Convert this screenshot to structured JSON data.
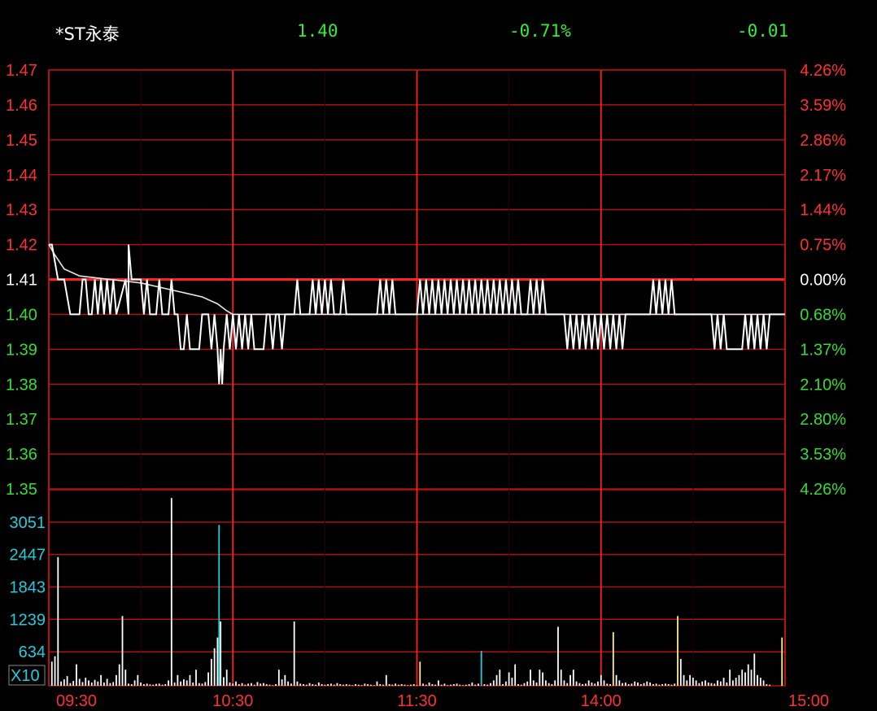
{
  "header": {
    "name": "*ST永泰",
    "price": "1.40",
    "change_pct": "-0.71%",
    "change": "-0.01"
  },
  "colors": {
    "background": "#000000",
    "grid": "#b01010",
    "grid_major": "#ff2020",
    "price_line": "#ffffff",
    "avg_line": "#ffffff",
    "up_text": "#ff3030",
    "down_text": "#33dd33",
    "neutral_text": "#ffffff",
    "volume_axis_text": "#22ccdd",
    "volume_bar": "#ffffff",
    "volume_bar_alt": "#ffee88",
    "volume_bar_alt2": "#22ccdd"
  },
  "chart_data": {
    "type": "line",
    "prev_close": 1.41,
    "price_axis": {
      "ticks": [
        "1.47",
        "1.46",
        "1.45",
        "1.44",
        "1.43",
        "1.42",
        "1.41",
        "1.40",
        "1.39",
        "1.38",
        "1.37",
        "1.36",
        "1.35"
      ],
      "ylim": [
        1.35,
        1.47
      ]
    },
    "pct_axis": {
      "ticks": [
        "4.26%",
        "3.59%",
        "2.86%",
        "2.17%",
        "1.44%",
        "0.75%",
        "0.00%",
        "0.68%",
        "1.37%",
        "2.10%",
        "2.80%",
        "3.53%",
        "4.26%"
      ]
    },
    "volume_axis": {
      "ticks": [
        "3051",
        "2447",
        "1843",
        "1239",
        "634"
      ],
      "unit": "X10",
      "ylim": [
        0,
        3655
      ]
    },
    "time_ticks": [
      "09:30",
      "10:30",
      "11:30",
      "14:00",
      "15:00"
    ],
    "total_minutes": 240,
    "price_series": [
      [
        0,
        1.42
      ],
      [
        1,
        1.42
      ],
      [
        3,
        1.41
      ],
      [
        5,
        1.41
      ],
      [
        7,
        1.4
      ],
      [
        10,
        1.4
      ],
      [
        11,
        1.41
      ],
      [
        12,
        1.41
      ],
      [
        13,
        1.4
      ],
      [
        14,
        1.4
      ],
      [
        15,
        1.41
      ],
      [
        16,
        1.4
      ],
      [
        17,
        1.41
      ],
      [
        18,
        1.4
      ],
      [
        19,
        1.41
      ],
      [
        20,
        1.4
      ],
      [
        21,
        1.41
      ],
      [
        22,
        1.4
      ],
      [
        26,
        1.4
      ],
      [
        27,
        1.41
      ],
      [
        25,
        1.41
      ],
      [
        26,
        1.42
      ],
      [
        27,
        1.41
      ],
      [
        30,
        1.41
      ],
      [
        31,
        1.4
      ],
      [
        32,
        1.41
      ],
      [
        33,
        1.4
      ],
      [
        35,
        1.4
      ],
      [
        36,
        1.41
      ],
      [
        37,
        1.4
      ],
      [
        39,
        1.4
      ],
      [
        40,
        1.41
      ],
      [
        41,
        1.4
      ],
      [
        42,
        1.4
      ],
      [
        43,
        1.39
      ],
      [
        44,
        1.39
      ],
      [
        45,
        1.4
      ],
      [
        46,
        1.39
      ],
      [
        49,
        1.39
      ],
      [
        50,
        1.4
      ],
      [
        52,
        1.4
      ],
      [
        53,
        1.39
      ],
      [
        54,
        1.4
      ],
      [
        55,
        1.39
      ],
      [
        55.5,
        1.38
      ],
      [
        56,
        1.39
      ],
      [
        56.5,
        1.38
      ],
      [
        57,
        1.39
      ],
      [
        58,
        1.4
      ],
      [
        59,
        1.39
      ],
      [
        60,
        1.4
      ],
      [
        61,
        1.39
      ],
      [
        62,
        1.4
      ],
      [
        63,
        1.39
      ],
      [
        64,
        1.4
      ],
      [
        65,
        1.39
      ],
      [
        66,
        1.4
      ],
      [
        67,
        1.39
      ],
      [
        70,
        1.39
      ],
      [
        71,
        1.4
      ],
      [
        72,
        1.4
      ],
      [
        73,
        1.39
      ],
      [
        74,
        1.4
      ],
      [
        75,
        1.4
      ],
      [
        76,
        1.39
      ],
      [
        77,
        1.4
      ],
      [
        80,
        1.4
      ],
      [
        81,
        1.41
      ],
      [
        82,
        1.4
      ],
      [
        85,
        1.4
      ],
      [
        86,
        1.41
      ],
      [
        87,
        1.4
      ],
      [
        88,
        1.41
      ],
      [
        89,
        1.4
      ],
      [
        90,
        1.41
      ],
      [
        91,
        1.4
      ],
      [
        92,
        1.41
      ],
      [
        93,
        1.4
      ],
      [
        95,
        1.4
      ],
      [
        96,
        1.41
      ],
      [
        97,
        1.4
      ],
      [
        107,
        1.4
      ],
      [
        108,
        1.41
      ],
      [
        109,
        1.4
      ],
      [
        110,
        1.41
      ],
      [
        111,
        1.4
      ],
      [
        112,
        1.41
      ],
      [
        113,
        1.4
      ],
      [
        120,
        1.4
      ],
      [
        121,
        1.41
      ],
      [
        122,
        1.4
      ],
      [
        123,
        1.41
      ],
      [
        124,
        1.4
      ],
      [
        125,
        1.41
      ],
      [
        126,
        1.4
      ],
      [
        127,
        1.41
      ],
      [
        128,
        1.4
      ],
      [
        129,
        1.41
      ],
      [
        130,
        1.4
      ],
      [
        131,
        1.41
      ],
      [
        132,
        1.4
      ],
      [
        133,
        1.41
      ],
      [
        134,
        1.4
      ],
      [
        135,
        1.41
      ],
      [
        136,
        1.4
      ],
      [
        137,
        1.41
      ],
      [
        138,
        1.4
      ],
      [
        139,
        1.41
      ],
      [
        140,
        1.4
      ],
      [
        141,
        1.41
      ],
      [
        142,
        1.4
      ],
      [
        143,
        1.41
      ],
      [
        144,
        1.4
      ],
      [
        145,
        1.41
      ],
      [
        146,
        1.4
      ],
      [
        147,
        1.41
      ],
      [
        148,
        1.4
      ],
      [
        149,
        1.41
      ],
      [
        150,
        1.4
      ],
      [
        151,
        1.41
      ],
      [
        152,
        1.4
      ],
      [
        153,
        1.41
      ],
      [
        154,
        1.4
      ],
      [
        156,
        1.4
      ],
      [
        157,
        1.41
      ],
      [
        158,
        1.4
      ],
      [
        159,
        1.41
      ],
      [
        160,
        1.4
      ],
      [
        161,
        1.41
      ],
      [
        162,
        1.4
      ],
      [
        168,
        1.4
      ],
      [
        169,
        1.39
      ],
      [
        170,
        1.4
      ],
      [
        171,
        1.39
      ],
      [
        172,
        1.4
      ],
      [
        173,
        1.39
      ],
      [
        174,
        1.4
      ],
      [
        175,
        1.39
      ],
      [
        176,
        1.4
      ],
      [
        177,
        1.39
      ],
      [
        178,
        1.4
      ],
      [
        179,
        1.39
      ],
      [
        180,
        1.4
      ],
      [
        181,
        1.39
      ],
      [
        182,
        1.4
      ],
      [
        183,
        1.39
      ],
      [
        184,
        1.4
      ],
      [
        185,
        1.39
      ],
      [
        186,
        1.4
      ],
      [
        187,
        1.39
      ],
      [
        188,
        1.4
      ],
      [
        196,
        1.4
      ],
      [
        197,
        1.41
      ],
      [
        198,
        1.4
      ],
      [
        199,
        1.41
      ],
      [
        200,
        1.4
      ],
      [
        201,
        1.41
      ],
      [
        202,
        1.4
      ],
      [
        203,
        1.41
      ],
      [
        204,
        1.4
      ],
      [
        216,
        1.4
      ],
      [
        217,
        1.39
      ],
      [
        218,
        1.4
      ],
      [
        219,
        1.39
      ],
      [
        220,
        1.4
      ],
      [
        221,
        1.39
      ],
      [
        226,
        1.39
      ],
      [
        227,
        1.4
      ],
      [
        228,
        1.39
      ],
      [
        229,
        1.4
      ],
      [
        230,
        1.39
      ],
      [
        231,
        1.4
      ],
      [
        232,
        1.39
      ],
      [
        233,
        1.4
      ],
      [
        234,
        1.39
      ],
      [
        235,
        1.4
      ],
      [
        240,
        1.4
      ]
    ],
    "avg_series": [
      [
        0,
        1.42
      ],
      [
        2,
        1.417
      ],
      [
        5,
        1.413
      ],
      [
        10,
        1.411
      ],
      [
        20,
        1.41
      ],
      [
        30,
        1.409
      ],
      [
        40,
        1.407
      ],
      [
        45,
        1.406
      ],
      [
        50,
        1.405
      ],
      [
        55,
        1.403
      ],
      [
        58,
        1.401
      ],
      [
        60,
        1.4
      ],
      [
        80,
        1.4
      ],
      [
        120,
        1.4
      ],
      [
        150,
        1.4
      ],
      [
        170,
        1.4
      ],
      [
        190,
        1.4
      ],
      [
        195,
        1.4
      ],
      [
        200,
        1.4
      ],
      [
        240,
        1.4
      ]
    ],
    "volume_series": [
      [
        1,
        450
      ],
      [
        2,
        550
      ],
      [
        3,
        2400
      ],
      [
        4,
        80
      ],
      [
        5,
        120
      ],
      [
        6,
        180
      ],
      [
        7,
        50
      ],
      [
        8,
        90
      ],
      [
        9,
        400
      ],
      [
        10,
        130
      ],
      [
        11,
        70
      ],
      [
        12,
        150
      ],
      [
        13,
        100
      ],
      [
        14,
        60
      ],
      [
        15,
        110
      ],
      [
        16,
        80
      ],
      [
        17,
        200
      ],
      [
        18,
        60
      ],
      [
        19,
        130
      ],
      [
        20,
        50
      ],
      [
        21,
        70
      ],
      [
        22,
        200
      ],
      [
        23,
        400
      ],
      [
        24,
        1300
      ],
      [
        25,
        300
      ],
      [
        26,
        40
      ],
      [
        27,
        30
      ],
      [
        28,
        100
      ],
      [
        29,
        200
      ],
      [
        30,
        60
      ],
      [
        31,
        30
      ],
      [
        32,
        40
      ],
      [
        33,
        25
      ],
      [
        34,
        20
      ],
      [
        35,
        35
      ],
      [
        36,
        40
      ],
      [
        37,
        20
      ],
      [
        38,
        30
      ],
      [
        39,
        100
      ],
      [
        40,
        3500
      ],
      [
        41,
        60
      ],
      [
        42,
        200
      ],
      [
        43,
        80
      ],
      [
        44,
        120
      ],
      [
        45,
        100
      ],
      [
        46,
        200
      ],
      [
        47,
        60
      ],
      [
        48,
        300
      ],
      [
        49,
        50
      ],
      [
        50,
        40
      ],
      [
        51,
        70
      ],
      [
        52,
        250
      ],
      [
        53,
        500
      ],
      [
        54,
        700
      ],
      [
        55,
        900
      ],
      [
        55.5,
        3000
      ],
      [
        56,
        1200
      ],
      [
        57,
        160
      ],
      [
        58,
        300
      ],
      [
        59,
        60
      ],
      [
        60,
        40
      ],
      [
        61,
        80
      ],
      [
        62,
        30
      ],
      [
        63,
        50
      ],
      [
        64,
        20
      ],
      [
        65,
        40
      ],
      [
        66,
        50
      ],
      [
        67,
        20
      ],
      [
        68,
        70
      ],
      [
        69,
        40
      ],
      [
        70,
        50
      ],
      [
        71,
        30
      ],
      [
        72,
        20
      ],
      [
        73,
        10
      ],
      [
        74,
        30
      ],
      [
        75,
        300
      ],
      [
        76,
        120
      ],
      [
        77,
        200
      ],
      [
        78,
        80
      ],
      [
        79,
        40
      ],
      [
        80,
        1200
      ],
      [
        81,
        80
      ],
      [
        82,
        40
      ],
      [
        83,
        30
      ],
      [
        84,
        20
      ],
      [
        85,
        50
      ],
      [
        86,
        30
      ],
      [
        87,
        20
      ],
      [
        88,
        60
      ],
      [
        89,
        30
      ],
      [
        90,
        20
      ],
      [
        91,
        30
      ],
      [
        92,
        40
      ],
      [
        93,
        20
      ],
      [
        94,
        50
      ],
      [
        95,
        30
      ],
      [
        96,
        20
      ],
      [
        97,
        30
      ],
      [
        98,
        20
      ],
      [
        99,
        10
      ],
      [
        100,
        30
      ],
      [
        101,
        20
      ],
      [
        102,
        10
      ],
      [
        103,
        40
      ],
      [
        104,
        30
      ],
      [
        105,
        20
      ],
      [
        106,
        10
      ],
      [
        107,
        80
      ],
      [
        108,
        30
      ],
      [
        109,
        20
      ],
      [
        110,
        200
      ],
      [
        111,
        30
      ],
      [
        112,
        20
      ],
      [
        113,
        40
      ],
      [
        114,
        20
      ],
      [
        115,
        30
      ],
      [
        116,
        20
      ],
      [
        117,
        10
      ],
      [
        118,
        20
      ],
      [
        119,
        30
      ],
      [
        120,
        10
      ],
      [
        121,
        450
      ],
      [
        122,
        40
      ],
      [
        123,
        20
      ],
      [
        124,
        60
      ],
      [
        125,
        30
      ],
      [
        126,
        20
      ],
      [
        127,
        100
      ],
      [
        128,
        20
      ],
      [
        129,
        40
      ],
      [
        130,
        10
      ],
      [
        131,
        20
      ],
      [
        132,
        30
      ],
      [
        133,
        40
      ],
      [
        134,
        20
      ],
      [
        135,
        10
      ],
      [
        136,
        20
      ],
      [
        137,
        30
      ],
      [
        138,
        60
      ],
      [
        139,
        20
      ],
      [
        140,
        40
      ],
      [
        141,
        650
      ],
      [
        142,
        30
      ],
      [
        143,
        20
      ],
      [
        144,
        50
      ],
      [
        145,
        100
      ],
      [
        146,
        200
      ],
      [
        147,
        300
      ],
      [
        148,
        30
      ],
      [
        149,
        80
      ],
      [
        150,
        250
      ],
      [
        151,
        150
      ],
      [
        152,
        400
      ],
      [
        153,
        30
      ],
      [
        154,
        20
      ],
      [
        155,
        50
      ],
      [
        156,
        80
      ],
      [
        157,
        300
      ],
      [
        158,
        100
      ],
      [
        159,
        60
      ],
      [
        160,
        300
      ],
      [
        161,
        250
      ],
      [
        162,
        100
      ],
      [
        163,
        50
      ],
      [
        164,
        30
      ],
      [
        165,
        100
      ],
      [
        166,
        1100
      ],
      [
        167,
        300
      ],
      [
        168,
        100
      ],
      [
        169,
        50
      ],
      [
        170,
        200
      ],
      [
        171,
        300
      ],
      [
        172,
        80
      ],
      [
        173,
        50
      ],
      [
        174,
        30
      ],
      [
        175,
        40
      ],
      [
        176,
        100
      ],
      [
        177,
        60
      ],
      [
        178,
        40
      ],
      [
        179,
        80
      ],
      [
        180,
        200
      ],
      [
        181,
        100
      ],
      [
        182,
        40
      ],
      [
        183,
        30
      ],
      [
        184,
        1000
      ],
      [
        185,
        200
      ],
      [
        186,
        100
      ],
      [
        187,
        50
      ],
      [
        188,
        60
      ],
      [
        189,
        30
      ],
      [
        190,
        40
      ],
      [
        191,
        80
      ],
      [
        192,
        60
      ],
      [
        193,
        30
      ],
      [
        194,
        50
      ],
      [
        195,
        80
      ],
      [
        196,
        60
      ],
      [
        197,
        30
      ],
      [
        198,
        40
      ],
      [
        199,
        20
      ],
      [
        200,
        30
      ],
      [
        201,
        40
      ],
      [
        202,
        30
      ],
      [
        203,
        20
      ],
      [
        204,
        40
      ],
      [
        205,
        1300
      ],
      [
        206,
        500
      ],
      [
        207,
        200
      ],
      [
        208,
        100
      ],
      [
        209,
        200
      ],
      [
        210,
        150
      ],
      [
        211,
        100
      ],
      [
        212,
        50
      ],
      [
        213,
        80
      ],
      [
        214,
        100
      ],
      [
        215,
        60
      ],
      [
        216,
        50
      ],
      [
        217,
        40
      ],
      [
        218,
        100
      ],
      [
        219,
        80
      ],
      [
        220,
        150
      ],
      [
        221,
        60
      ],
      [
        222,
        300
      ],
      [
        223,
        100
      ],
      [
        224,
        150
      ],
      [
        225,
        200
      ],
      [
        226,
        300
      ],
      [
        227,
        250
      ],
      [
        228,
        400
      ],
      [
        229,
        300
      ],
      [
        230,
        600
      ],
      [
        231,
        200
      ],
      [
        232,
        150
      ],
      [
        233,
        100
      ],
      [
        234,
        30
      ],
      [
        235,
        20
      ],
      [
        239,
        900
      ]
    ]
  }
}
